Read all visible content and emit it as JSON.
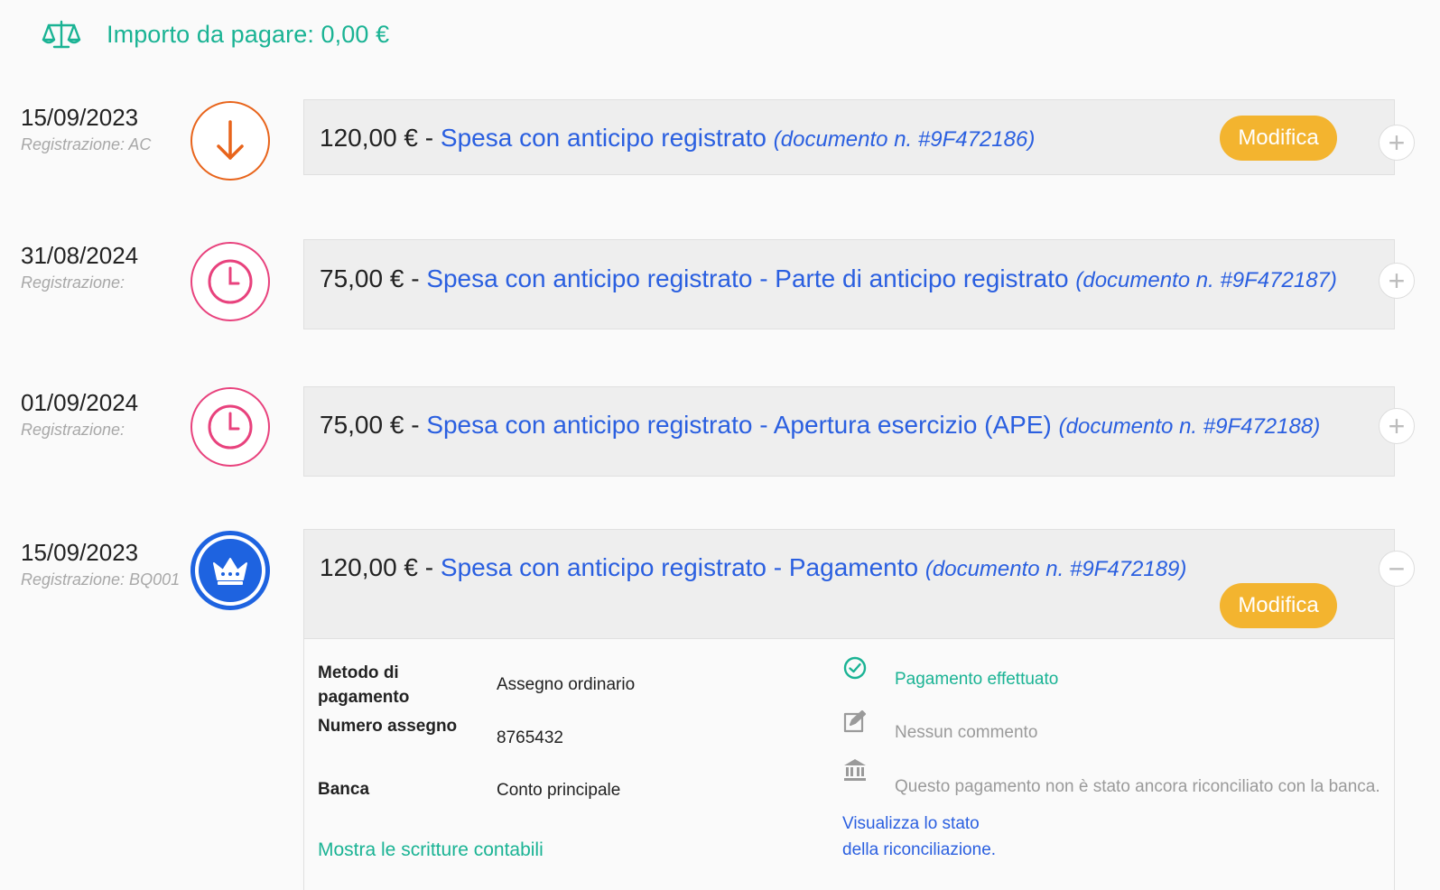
{
  "header": {
    "amount_label": "Importo da pagare: 0,00 €",
    "icon": "scale-icon"
  },
  "colors": {
    "accent_green": "#1ab394",
    "link_blue": "#2a5fe0",
    "button_yellow": "#f3b42f",
    "orange": "#e8641b",
    "pink": "#e8427d",
    "blue": "#1e63e0"
  },
  "entries": [
    {
      "date": "15/09/2023",
      "registration": "Registrazione: AC",
      "icon": "arrow-down-icon",
      "amount": "120,00 €",
      "separator": " - ",
      "description": "Spesa con anticipo registrato",
      "document": "(documento n. #9F472186)",
      "button": "Modifica",
      "toggle": "+"
    },
    {
      "date": "31/08/2024",
      "registration": "Registrazione:",
      "icon": "clock-icon",
      "amount": "75,00 €",
      "separator": " - ",
      "description": "Spesa con anticipo registrato - Parte di anticipo registrato",
      "document": "(documento n. #9F472187)",
      "toggle": "+"
    },
    {
      "date": "01/09/2024",
      "registration": "Registrazione:",
      "icon": "clock-icon",
      "amount": "75,00 €",
      "separator": " - ",
      "description": "Spesa con anticipo registrato - Apertura esercizio (APE)",
      "document": "(documento n. #9F472188)",
      "toggle": "+"
    },
    {
      "date": "15/09/2023",
      "registration": "Registrazione: BQ001",
      "icon": "crown-icon",
      "amount": "120,00 €",
      "separator": " - ",
      "description": "Spesa con anticipo registrato - Pagamento",
      "document": "(documento n. #9F472189)",
      "button": "Modifica",
      "toggle": "−"
    }
  ],
  "details": {
    "payment_method_label": "Metodo di pagamento",
    "payment_method_value": "Assegno ordinario",
    "check_number_label": "Numero assegno",
    "check_number_value": "8765432",
    "bank_label": "Banca",
    "bank_value": "Conto principale",
    "show_entries_link": "Mostra le scritture contabili",
    "payment_status": "Pagamento effettuato",
    "comment": "Nessun commento",
    "reconciliation_note": "Questo pagamento non è stato ancora riconciliato con la banca.",
    "reconciliation_link_line1": "Visualizza lo stato",
    "reconciliation_link_line2": "della riconciliazione."
  }
}
